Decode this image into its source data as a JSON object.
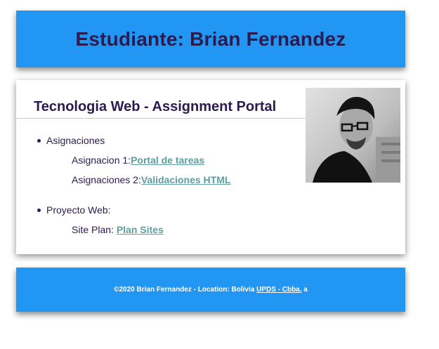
{
  "header": {
    "title": "Estudiante: Brian Fernandez"
  },
  "card": {
    "title": "Tecnologia Web - Assignment Portal",
    "items": [
      {
        "label": "Asignaciones",
        "subitems": [
          {
            "prefix": "Asignacion 1:",
            "link": "Portal de tareas"
          },
          {
            "prefix": "Asignaciones 2:",
            "link": "Validaciones HTML"
          }
        ]
      },
      {
        "label": "Proyecto Web:",
        "subitems": [
          {
            "prefix": "Site Plan: ",
            "link": "Plan Sites"
          }
        ]
      }
    ]
  },
  "footer": {
    "text": "©2020 Brian Fernandez - Location: Bolivia ",
    "link": "UPDS - Cbba.",
    "suffix": " a"
  },
  "colors": {
    "brand_blue": "#2196f3",
    "heading": "#2b1b4f",
    "link": "#5f9ea0"
  }
}
